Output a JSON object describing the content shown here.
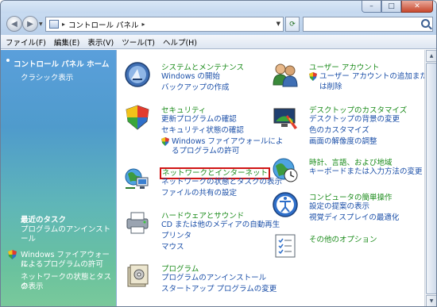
{
  "window": {
    "buttons": {
      "minimize": "–",
      "maximize": "□",
      "close": "✕"
    }
  },
  "address": {
    "path": "コントロール パネル",
    "separator": "▸",
    "search_placeholder": ""
  },
  "menu": [
    "ファイル(F)",
    "編集(E)",
    "表示(V)",
    "ツール(T)",
    "ヘルプ(H)"
  ],
  "sidebar": {
    "home": "コントロール パネル ホーム",
    "classic": "クラシック表示",
    "recent_title": "最近のタスク",
    "recent": [
      "プログラムのアンインストール",
      "Windows ファイアウォール",
      "によるプログラムの許可",
      "ネットワークの状態とタスク",
      "の表示"
    ]
  },
  "categories": {
    "system": {
      "title": "システムとメンテナンス",
      "links": [
        "Windows の開始",
        "バックアップの作成"
      ]
    },
    "security": {
      "title": "セキュリティ",
      "links": [
        "更新プログラムの確認",
        "セキュリティ状態の確認",
        "Windows ファイアウォールによ",
        "るプログラムの許可"
      ]
    },
    "network": {
      "title": "ネットワークとインターネット",
      "links": [
        "ネットワークの状態とタスクの表示",
        "ファイルの共有の設定"
      ]
    },
    "hardware": {
      "title": "ハードウェアとサウンド",
      "links": [
        "CD または他のメディアの自動再生",
        "プリンタ",
        "マウス"
      ]
    },
    "programs": {
      "title": "プログラム",
      "links": [
        "プログラムのアンインストール",
        "スタートアップ プログラムの変更"
      ]
    },
    "users": {
      "title": "ユーザー アカウント",
      "links": [
        "ユーザー アカウントの追加また",
        "は削除"
      ]
    },
    "appearance": {
      "title": "デスクトップのカスタマイズ",
      "links": [
        "デスクトップの背景の変更",
        "色のカスタマイズ",
        "画面の解像度の調整"
      ]
    },
    "clock": {
      "title": "時計、言語、および地域",
      "links": [
        "キーボードまたは入力方法の変更"
      ]
    },
    "ease": {
      "title": "コンピュータの簡単操作",
      "links": [
        "設定の提案の表示",
        "視覚ディスプレイの最適化"
      ]
    },
    "other": {
      "title": "その他のオプション",
      "links": []
    }
  },
  "colors": {
    "title_green": "#1c8c1c",
    "link_blue": "#1b4fa8",
    "highlight_red": "#d01414"
  }
}
